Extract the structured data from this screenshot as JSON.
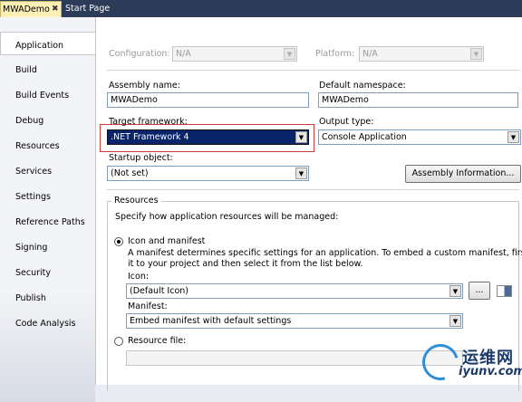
{
  "tabs": {
    "active": "MWADemo",
    "close_glyph": "✖",
    "inactive": "Start Page"
  },
  "sidebar": {
    "items": [
      {
        "label": "Application",
        "selected": true
      },
      {
        "label": "Build"
      },
      {
        "label": "Build Events"
      },
      {
        "label": "Debug"
      },
      {
        "label": "Resources"
      },
      {
        "label": "Services"
      },
      {
        "label": "Settings"
      },
      {
        "label": "Reference Paths"
      },
      {
        "label": "Signing"
      },
      {
        "label": "Security"
      },
      {
        "label": "Publish"
      },
      {
        "label": "Code Analysis"
      }
    ]
  },
  "config": {
    "configuration_label": "Configuration:",
    "configuration_value": "N/A",
    "platform_label": "Platform:",
    "platform_value": "N/A"
  },
  "app": {
    "assembly_name_label": "Assembly name:",
    "assembly_name_value": "MWADemo",
    "default_namespace_label": "Default namespace:",
    "default_namespace_value": "MWADemo",
    "target_framework_label": "Target framework:",
    "target_framework_value": ".NET Framework 4",
    "output_type_label": "Output type:",
    "output_type_value": "Console Application",
    "startup_object_label": "Startup object:",
    "startup_object_value": "(Not set)",
    "assembly_info_button": "Assembly Information..."
  },
  "resources": {
    "group_title": "Resources",
    "description": "Specify how application resources will be managed:",
    "icon_manifest_label": "Icon and manifest",
    "icon_manifest_desc_1": "A manifest determines specific settings for an application. To embed a custom manifest, first add",
    "icon_manifest_desc_2": "it to your project and then select it from the list below.",
    "icon_label": "Icon:",
    "icon_value": "(Default Icon)",
    "browse_button": "...",
    "manifest_label": "Manifest:",
    "manifest_value": "Embed manifest with default settings",
    "resource_file_label": "Resource file:",
    "resource_file_value": ""
  },
  "watermark": {
    "cn": "运维网",
    "en": "iyunv.com"
  },
  "colors": {
    "tabbar": "#2b3b58",
    "active_tab": "#fcf0b6",
    "highlight": "#0a246a",
    "callout": "#d23a3a"
  }
}
